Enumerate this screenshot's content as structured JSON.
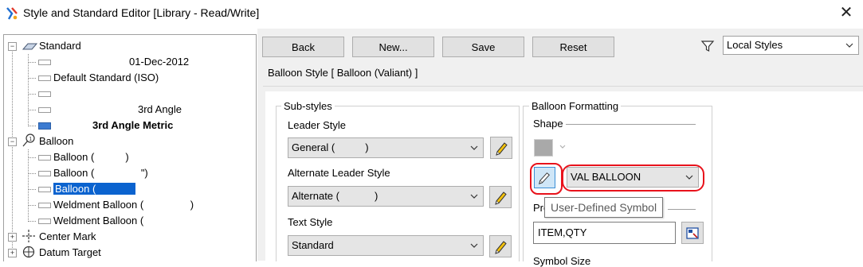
{
  "window": {
    "title": "Style and Standard Editor [Library - Read/Write]"
  },
  "tree": {
    "items": [
      {
        "label": "Standard",
        "bold": false
      },
      {
        "label": "01-Dec-2012",
        "bold": false
      },
      {
        "label": "Default Standard (ISO)",
        "bold": false
      },
      {
        "label": "",
        "bold": false
      },
      {
        "label": "3rd Angle",
        "bold": false
      },
      {
        "label": "3rd Angle Metric",
        "bold": true
      },
      {
        "label": "Balloon",
        "bold": false
      },
      {
        "label": "Balloon (",
        "bold": false
      },
      {
        "label": "Balloon (",
        "bold": false
      },
      {
        "label": "Balloon (",
        "bold": false
      },
      {
        "label": "Weldment Balloon (",
        "bold": false
      },
      {
        "label": "Weldment Balloon (",
        "bold": false
      },
      {
        "label": "Center Mark",
        "bold": false
      },
      {
        "label": "Datum Target",
        "bold": false
      }
    ],
    "suffix_1": ")",
    "suffix_2": "\")",
    "suffix_4": ")"
  },
  "toolbar": {
    "back_label": "Back",
    "new_label": "New...",
    "save_label": "Save",
    "reset_label": "Reset",
    "filter_value": "Local Styles"
  },
  "section": {
    "title": "Balloon Style [ Balloon (Valiant) ]"
  },
  "substyles": {
    "group_label": "Sub-styles",
    "leader_style_label": "Leader Style",
    "leader_style_value": "General (",
    "leader_style_suffix": ")",
    "alt_leader_style_label": "Alternate Leader Style",
    "alt_leader_style_value": "Alternate (",
    "alt_leader_style_suffix": ")",
    "text_style_label": "Text Style",
    "text_style_value": "Standard"
  },
  "formatting": {
    "group_label": "Balloon Formatting",
    "shape_label": "Shape",
    "symbol_value": "VAL BALLOON",
    "tooltip": "User-Defined Symbol",
    "properties_label_partial": "Pro",
    "properties_value": "ITEM,QTY",
    "symbol_size_label": "Symbol Size"
  },
  "colors": {
    "selection": "#0b63cf",
    "annotation_ring": "#e8121b",
    "pencil_yellow": "#f4c20d"
  }
}
